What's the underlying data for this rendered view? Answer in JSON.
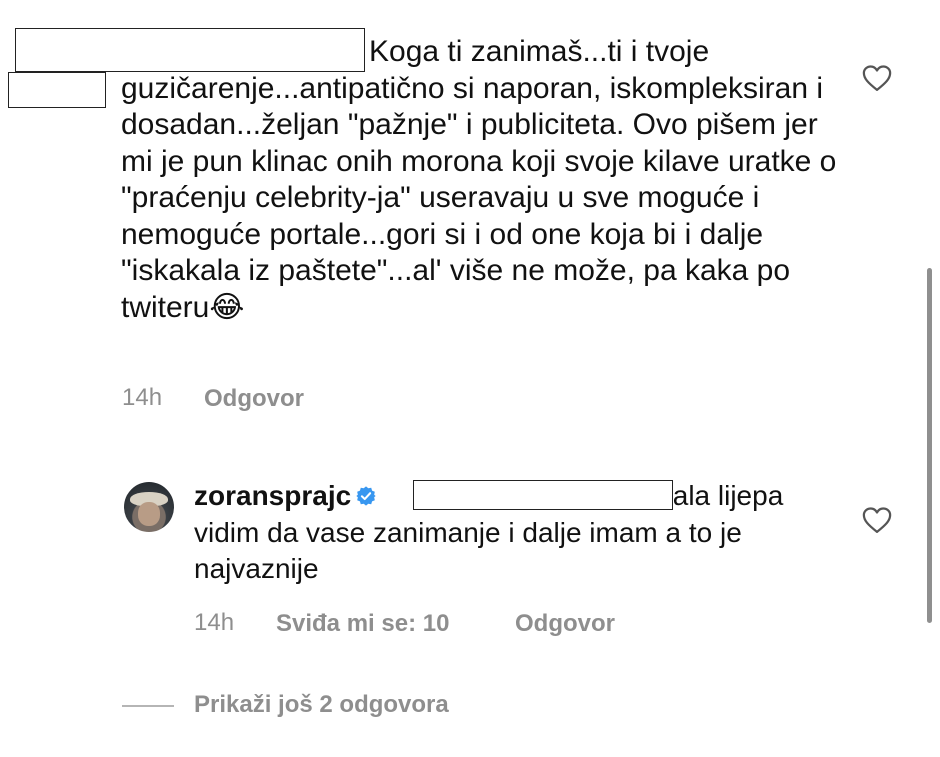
{
  "comment": {
    "text": "Koga ti zanimaš...ti i tvoje guzičarenje...antipatično si naporan, iskompleksiran i dosadan...željan \"pažnje\" i publiciteta. Ovo pišem jer mi je pun klinac onih morona koji svoje kilave uratke o \"praćenju celebrity-ja\" useravaju u sve moguće i nemoguće portale...gori si i od one koja bi i dalje \"iskakala iz paštete\"...al' više ne može, pa kaka po twiteru😂",
    "time": "14h",
    "reply_label": "Odgovor",
    "like_icon": "heart-outline-icon"
  },
  "reply": {
    "username": "zoransprajc",
    "verified_icon": "verified-badge-icon",
    "text": "hvala lijepa vidim da vase zanimanje i dalje imam a to je najvaznije",
    "time": "14h",
    "likes_label": "Sviđa mi se: 10",
    "reply_label": "Odgovor",
    "like_icon": "heart-outline-icon"
  },
  "thread": {
    "show_more_label": "Prikaži još 2 odgovora"
  },
  "colors": {
    "text": "#111111",
    "meta": "#8e8e8e",
    "verified": "#3897f0"
  }
}
